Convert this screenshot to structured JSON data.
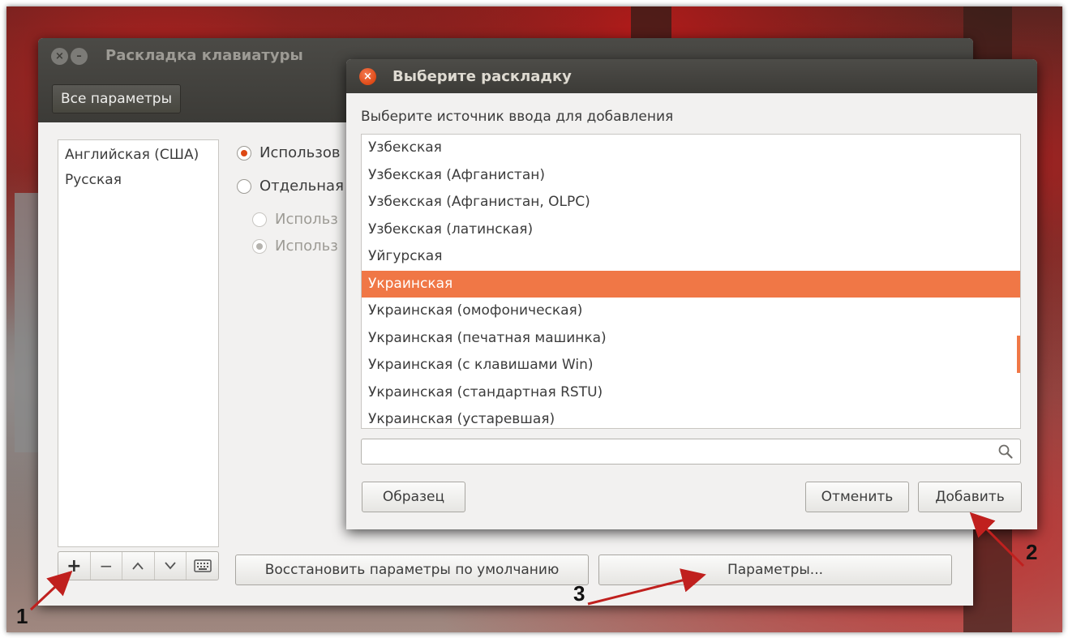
{
  "main_window": {
    "title": "Раскладка клавиатуры",
    "all_settings_label": "Все параметры",
    "layouts": [
      "Английская (США)",
      "Русская"
    ],
    "options": [
      {
        "label": "Использов",
        "selected": true,
        "disabled": false
      },
      {
        "label": "Отдельная",
        "selected": false,
        "disabled": false
      },
      {
        "label": "Использ",
        "selected": false,
        "disabled": true
      },
      {
        "label": "Использ",
        "selected": true,
        "disabled": true
      }
    ],
    "toolbar": {
      "add": "+",
      "remove": "−",
      "up": "^",
      "down": "v",
      "keyboard_icon": "keyboard-icon"
    },
    "restore_defaults_label": "Восстановить параметры по умолчанию",
    "options_button_label": "Параметры..."
  },
  "dialog": {
    "title": "Выберите раскладку",
    "prompt": "Выберите источник ввода для добавления",
    "items": [
      "Узбекская",
      "Узбекская (Афганистан)",
      "Узбекская (Афганистан, OLPC)",
      "Узбекская (латинская)",
      "Уйгурская",
      "Украинская",
      "Украинская (омофоническая)",
      "Украинская (печатная машинка)",
      "Украинская (с клавишами Win)",
      "Украинская (стандартная RSTU)",
      "Украинская (устаревшая)"
    ],
    "selected_index": 5,
    "search_value": "",
    "search_icon": "search-icon",
    "sample_label": "Образец",
    "cancel_label": "Отменить",
    "add_label": "Добавить"
  },
  "annotations": {
    "labels": [
      "1",
      "2",
      "3"
    ],
    "arrow_color": "#c0201e"
  },
  "colors": {
    "accent": "#dd4814",
    "selection": "#f07746",
    "titlebar": "#3c3b37"
  }
}
